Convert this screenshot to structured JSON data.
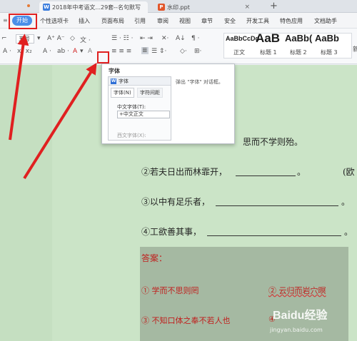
{
  "tabs": [
    {
      "icon": "W",
      "label": "2018年中考语文...29套--名句默写"
    },
    {
      "icon": "P",
      "label": "水印.ppt"
    }
  ],
  "menu": {
    "left_glyph": "≡",
    "home_label": "开始",
    "items": [
      "个性选项卡",
      "插入",
      "页面布局",
      "引用",
      "审阅",
      "视图",
      "章节",
      "安全",
      "开发工具",
      "特色应用",
      "文档助手"
    ]
  },
  "toolbar": {
    "font_name": "五号",
    "styles": [
      {
        "preview": "AaBbCcDd",
        "label": "正文"
      },
      {
        "preview": "AaB",
        "label": "标题 1"
      },
      {
        "preview": "AaBb(",
        "label": "标题 2"
      },
      {
        "preview": "AaBb",
        "label": "标题 3"
      }
    ],
    "new_style_label": "新"
  },
  "tooltip": {
    "title": "字体",
    "description": "弹出 \"字体\" 对话框。",
    "mini_dialog": {
      "title": "字体",
      "tab1": "字体(N)",
      "tab2": "字符间距",
      "field_label": "中文字体(T):",
      "field_value": "+中文正文",
      "field_label2": "西文字体(X):"
    }
  },
  "document": {
    "line0": "思而不学则殆。",
    "line1": "②若夫日出而林霏开，",
    "line1_end": "。",
    "line1_extra": "(欧",
    "line2": "③以中有足乐者，",
    "line2_end": "。",
    "line3": "④工欲善其事，",
    "line3_end": "。",
    "answer_label": "答案：",
    "answer1": "① 学而不思则罔",
    "answer2": "② 云归而岩穴暝",
    "answer3": "③ 不知口体之奉不若人也",
    "answer4": "④"
  },
  "watermark": {
    "main": "Baidu经验",
    "sub": "jingyan.baidu.com"
  },
  "colors": {
    "accent": "#4b8ee8",
    "annotation": "#e02020",
    "doc_bg": "#cbe4c7",
    "answer_text": "#c0201e"
  }
}
